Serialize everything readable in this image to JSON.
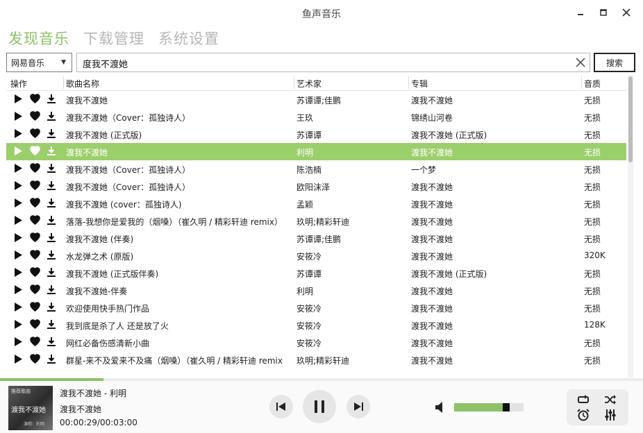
{
  "window": {
    "title": "鱼声音乐"
  },
  "tabs": [
    {
      "label": "发现音乐",
      "active": true
    },
    {
      "label": "下载管理",
      "active": false
    },
    {
      "label": "系统设置",
      "active": false
    }
  ],
  "search": {
    "source": "网易音乐",
    "query": "度我不渡她",
    "button_label": "搜索"
  },
  "table": {
    "headers": {
      "actions": "操作",
      "name": "歌曲名称",
      "artist": "艺术家",
      "album": "专辑",
      "quality": "音质"
    },
    "rows": [
      {
        "name": "渡我不渡她",
        "artist": "苏谭谭;佳鹏",
        "album": "渡我不渡她",
        "quality": "无损"
      },
      {
        "name": "渡我不渡她（Cover：孤独诗人）",
        "artist": "王玖",
        "album": "锦绣山河卷",
        "quality": "无损"
      },
      {
        "name": "渡我不渡她 (正式版)",
        "artist": "苏谭谭",
        "album": "渡我不渡她 (正式版)",
        "quality": "无损"
      },
      {
        "name": "渡我不渡她",
        "artist": "利明",
        "album": "渡我不渡她",
        "quality": "无损"
      },
      {
        "name": "渡我不渡她（Cover：孤独诗人）",
        "artist": "陈浩楠",
        "album": "一个梦",
        "quality": "无损"
      },
      {
        "name": "渡我不渡她（Cover：孤独诗人）",
        "artist": "欧阳沫泽",
        "album": "渡我不渡她",
        "quality": "无损"
      },
      {
        "name": "渡我不渡她 (cover：孤独诗人)",
        "artist": "孟颖",
        "album": "渡我不渡她",
        "quality": "无损"
      },
      {
        "name": "落落-我想你是爱我的（烟嗓）（崔久明 / 精彩轩迪 remix）",
        "artist": "玖明;精彩轩迪",
        "album": "渡我不渡她",
        "quality": "无损"
      },
      {
        "name": "渡我不渡她 (伴奏)",
        "artist": "苏谭谭;佳鹏",
        "album": "渡我不渡她",
        "quality": "无损"
      },
      {
        "name": "水龙弹之术 (原版)",
        "artist": "安筱冷",
        "album": "渡我不渡她",
        "quality": "320K"
      },
      {
        "name": "渡我不渡她 (正式版伴奏)",
        "artist": "苏谭谭",
        "album": "渡我不渡她 (正式版)",
        "quality": "无损"
      },
      {
        "name": "渡我不渡她-伴奏",
        "artist": "利明",
        "album": "渡我不渡她",
        "quality": "无损"
      },
      {
        "name": "欢迎使用快手热门作品",
        "artist": "安筱冷",
        "album": "渡我不渡她",
        "quality": "无损"
      },
      {
        "name": "我到底是杀了人 还是放了火",
        "artist": "安筱冷",
        "album": "渡我不渡她",
        "quality": "128K"
      },
      {
        "name": "网红必备伤感清新小曲",
        "artist": "安筱冷",
        "album": "渡我不渡她",
        "quality": "无损"
      },
      {
        "name": "群星-来不及爱来不及痛（烟嗓）（崔久明 / 精彩轩迪 remix",
        "artist": "玖明;精彩轩迪",
        "album": "渡我不渡她",
        "quality": "无损"
      }
    ],
    "selected_index": 3
  },
  "player": {
    "cover": {
      "top": "推荐歌曲",
      "title": "渡我不渡她",
      "sub": "演唱：利明"
    },
    "title_line": "渡我不渡她 - 利明",
    "album_line": "渡我不渡她",
    "time": "00:00:29/00:03:00",
    "progress": 0.161,
    "volume": 0.8
  },
  "colors": {
    "accent": "#8cc265",
    "selected_row": "#9bcf6b"
  },
  "icons": {
    "row_actions": [
      "play-icon",
      "heart-icon",
      "download-icon"
    ],
    "transport": [
      "previous-icon",
      "pause-icon",
      "next-icon"
    ],
    "panel": [
      "repeat-icon",
      "shuffle-icon",
      "alarm-clock-icon",
      "equalizer-icon"
    ]
  }
}
